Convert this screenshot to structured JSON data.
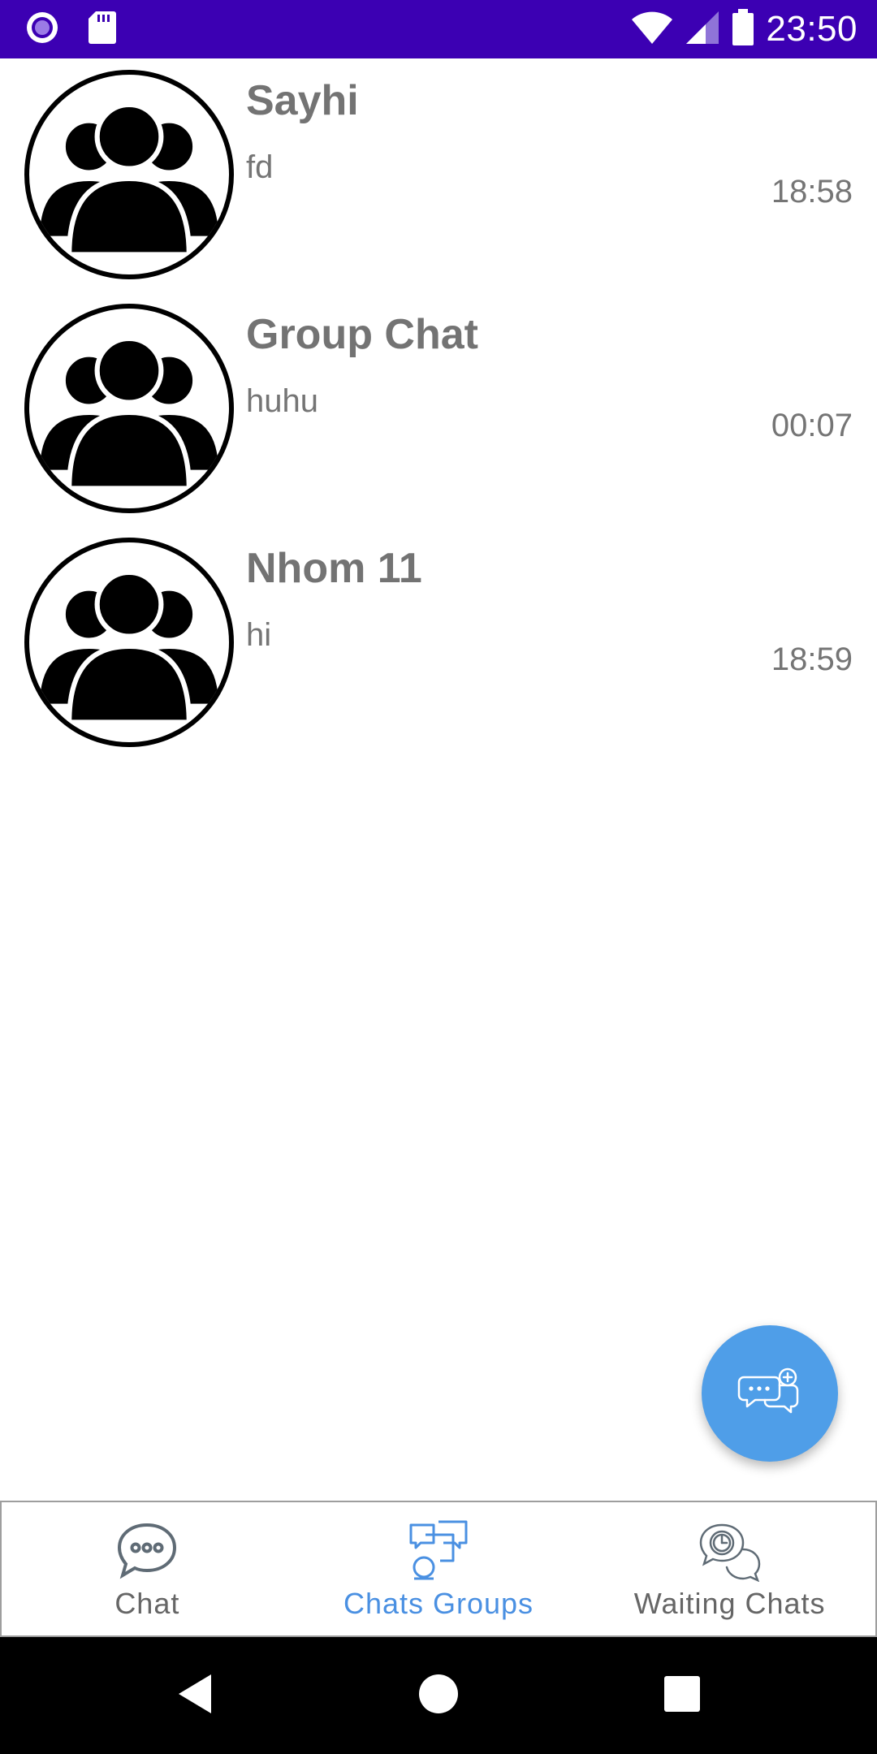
{
  "status_bar": {
    "time": "23:50",
    "icons": [
      "record-icon",
      "sd-card-icon",
      "wifi-icon",
      "signal-icon",
      "battery-icon"
    ],
    "background": "#3c00b3"
  },
  "chats": [
    {
      "name": "Sayhi",
      "last_message": "fd",
      "time": "18:58",
      "avatar": "group-avatar-icon"
    },
    {
      "name": "Group Chat",
      "last_message": "huhu",
      "time": "00:07",
      "avatar": "group-avatar-icon"
    },
    {
      "name": "Nhom 11",
      "last_message": "hi",
      "time": "18:59",
      "avatar": "group-avatar-icon"
    }
  ],
  "fab": {
    "icon": "new-chat-icon",
    "color": "#4f9ee8"
  },
  "bottom_nav": {
    "items": [
      {
        "label": "Chat",
        "icon": "chat-bubble-icon",
        "active": false
      },
      {
        "label": "Chats Groups",
        "icon": "chat-groups-icon",
        "active": true
      },
      {
        "label": "Waiting Chats",
        "icon": "waiting-chats-icon",
        "active": false
      }
    ],
    "active_color": "#4a90e2",
    "inactive_color": "#666666"
  },
  "system_nav": {
    "icons": [
      "back-icon",
      "home-icon",
      "recents-icon"
    ]
  }
}
